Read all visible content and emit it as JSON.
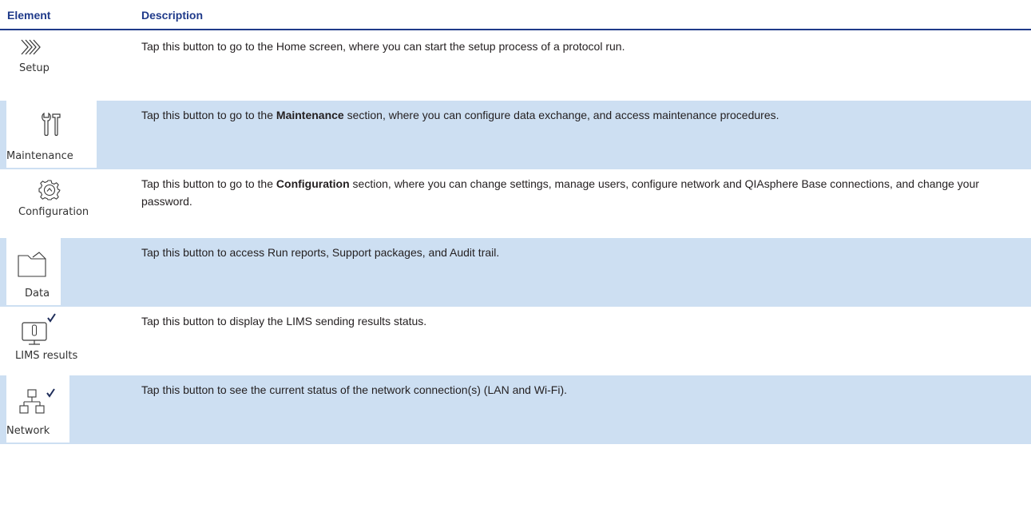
{
  "header": {
    "element": "Element",
    "description": "Description"
  },
  "rows": [
    {
      "label": "Setup",
      "icon": "chevrons-right-icon",
      "description": "Tap this button to go to the Home screen, where you can start the setup process of a protocol run."
    },
    {
      "label": "Maintenance",
      "icon": "tools-icon",
      "desc_pre": "Tap this button to go to the ",
      "desc_bold": "Maintenance",
      "desc_post": " section, where you can configure data exchange, and access maintenance procedures."
    },
    {
      "label": "Configuration",
      "icon": "gear-icon",
      "desc_pre": "Tap this button to go to the ",
      "desc_bold": "Configuration",
      "desc_post": " section, where you can change settings, manage users, configure network and QIAsphere Base connections, and change your password."
    },
    {
      "label": "Data",
      "icon": "folder-icon",
      "description": "Tap this button to access Run reports, Support packages, and Audit trail."
    },
    {
      "label": "LIMS results",
      "icon": "monitor-check-icon",
      "description": "Tap this button to display the LIMS sending results status."
    },
    {
      "label": "Network",
      "icon": "network-check-icon",
      "description": "Tap this button to see the current status of the network connection(s) (LAN and Wi-Fi)."
    }
  ],
  "colors": {
    "header_text": "#1f3a8a",
    "row_shade": "#cddff2",
    "body_text": "#231f20"
  }
}
